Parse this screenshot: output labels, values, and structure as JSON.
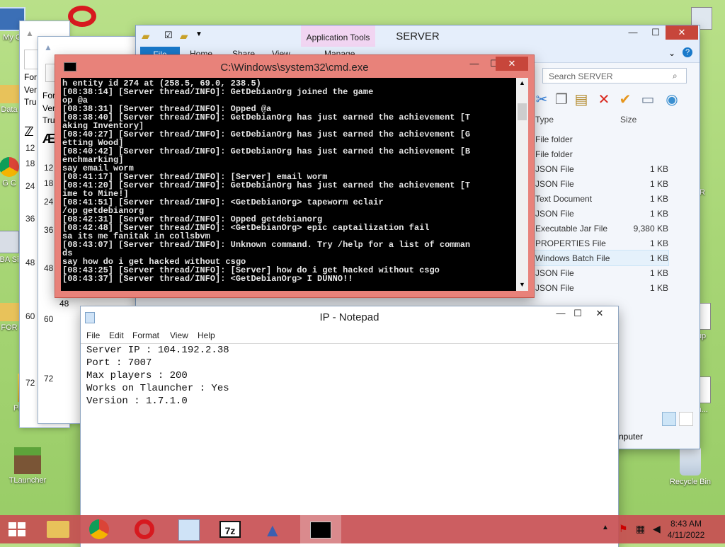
{
  "desktop": {
    "icons": [
      {
        "label": "My C",
        "icon": "computer-icon"
      },
      {
        "label": "Data",
        "icon": "folder-icon"
      },
      {
        "label": "G C",
        "icon": "chrome-icon"
      },
      {
        "label": "BA Si",
        "icon": "batch-icon"
      },
      {
        "label": "FOR",
        "icon": "folder-icon"
      },
      {
        "label": "Portecle",
        "icon": "portecle-icon"
      },
      {
        "label": "TLauncher",
        "icon": "minecraft-block-icon"
      },
      {
        "label": "Recycle Bin",
        "icon": "recycle-bin-icon"
      },
      {
        "label": "up",
        "icon": "file-icon"
      },
      {
        "label": "in...",
        "icon": "file-icon"
      },
      {
        "label": "R",
        "icon": "file-icon"
      }
    ]
  },
  "bg_windows": {
    "left_text": [
      "For",
      "Ver",
      "Tru"
    ],
    "left_text2": [
      "For",
      "Ver",
      "Tru"
    ],
    "numbers_a": [
      "12",
      "18",
      "24",
      "36",
      "48",
      "60",
      "72"
    ],
    "numbers_b": [
      "12",
      "18",
      "24",
      "36",
      "48",
      "60",
      "72"
    ],
    "extra_num": "48"
  },
  "explorer": {
    "title": "SERVER",
    "tabs": {
      "file": "File",
      "home": "Home",
      "share": "Share",
      "view": "View",
      "manage": "Manage"
    },
    "app_tools": "Application Tools",
    "search_placeholder": "Search SERVER",
    "columns": {
      "type": "Type",
      "size": "Size"
    },
    "files": [
      {
        "type": "File folder",
        "size": ""
      },
      {
        "type": "File folder",
        "size": ""
      },
      {
        "type": "JSON File",
        "size": "1 KB"
      },
      {
        "type": "JSON File",
        "size": "1 KB"
      },
      {
        "type": "Text Document",
        "size": "1 KB"
      },
      {
        "type": "JSON File",
        "size": "1 KB"
      },
      {
        "type": "Executable Jar File",
        "size": "9,380 KB"
      },
      {
        "type": "PROPERTIES File",
        "size": "1 KB"
      },
      {
        "type": "Windows Batch File",
        "size": "1 KB"
      },
      {
        "type": "JSON File",
        "size": "1 KB"
      },
      {
        "type": "JSON File",
        "size": "1 KB"
      }
    ],
    "status_text": "nputer"
  },
  "cmd": {
    "title": "C:\\Windows\\system32\\cmd.exe",
    "lines": [
      "h entity id 274 at (258.5, 69.0, 238.5)",
      "[08:38:14] [Server thread/INFO]: GetDebianOrg joined the game",
      "op @a",
      "[08:38:31] [Server thread/INFO]: Opped @a",
      "[08:38:40] [Server thread/INFO]: GetDebianOrg has just earned the achievement [T",
      "aking Inventory]",
      "[08:40:27] [Server thread/INFO]: GetDebianOrg has just earned the achievement [G",
      "etting Wood]",
      "[08:40:42] [Server thread/INFO]: GetDebianOrg has just earned the achievement [B",
      "enchmarking]",
      "say email worm",
      "[08:41:17] [Server thread/INFO]: [Server] email worm",
      "[08:41:20] [Server thread/INFO]: GetDebianOrg has just earned the achievement [T",
      "ime to Mine!]",
      "[08:41:51] [Server thread/INFO]: <GetDebianOrg> tapeworm eclair",
      "/op getdebianorg",
      "[08:42:31] [Server thread/INFO]: Opped getdebianorg",
      "[08:42:48] [Server thread/INFO]: <GetDebianOrg> epic captailization fail",
      "sa its me fanitak in collsbvm",
      "[08:43:07] [Server thread/INFO]: Unknown command. Try /help for a list of comman",
      "ds",
      "say how do i get hacked without csgo",
      "[08:43:25] [Server thread/INFO]: [Server] how do i get hacked without csgo",
      "[08:43:37] [Server thread/INFO]: <GetDebianOrg> I DUNNO!!"
    ]
  },
  "notepad": {
    "title": "IP - Notepad",
    "menu": [
      "File",
      "Edit",
      "Format",
      "View",
      "Help"
    ],
    "content": [
      "Server IP : 104.192.2.38",
      "Port : 7007",
      "Max players : 200",
      "Works on Tlauncher : Yes",
      "Version : 1.7.1.0"
    ]
  },
  "taskbar": {
    "time": "8:43 AM",
    "date": "4/11/2022"
  }
}
